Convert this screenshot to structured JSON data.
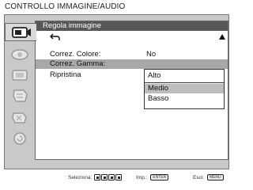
{
  "title": "CONTROLLO IMMAGINE/AUDIO",
  "sidebar": {
    "items": [
      {
        "icon": "input-icon",
        "active": true
      },
      {
        "icon": "picture-icon",
        "active": false
      },
      {
        "icon": "screen-icon",
        "active": false
      },
      {
        "icon": "setup-icon",
        "active": false
      },
      {
        "icon": "tool-icon",
        "active": false
      },
      {
        "icon": "info-icon",
        "active": false
      }
    ]
  },
  "panel": {
    "header": "Regola immagine",
    "rows": [
      {
        "label": "Correz. Colore:",
        "value": "No"
      },
      {
        "label": "Correz. Gamma:",
        "value": ""
      },
      {
        "label": "Ripristina",
        "value": ""
      }
    ]
  },
  "dropdown": {
    "options": [
      "Alto",
      "Medio",
      "Basso"
    ],
    "selected": "Medio"
  },
  "footer": {
    "select_label": "Seleziona",
    "enter_label": "Imp.",
    "exit_label": "Esci",
    "enter_key": "ENTER",
    "exit_key": "MENU"
  }
}
